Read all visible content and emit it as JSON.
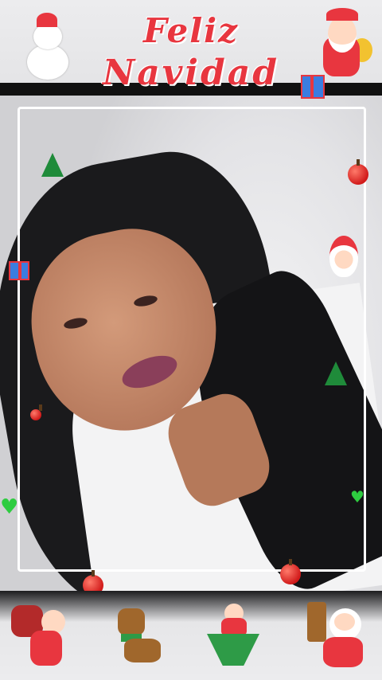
{
  "header": {
    "title_line1": "Feliz",
    "title_line2": "Navidad"
  },
  "colors": {
    "title": "#e8363f",
    "header_bar": "#111111",
    "frame_border": "#ffffff"
  },
  "decorations": [
    "snowman-icon",
    "santa-claus-icon",
    "gift-box-icon",
    "christmas-tree-icon",
    "apple-icon",
    "santa-face-icon",
    "green-heart-icon",
    "reindeer-icon"
  ]
}
